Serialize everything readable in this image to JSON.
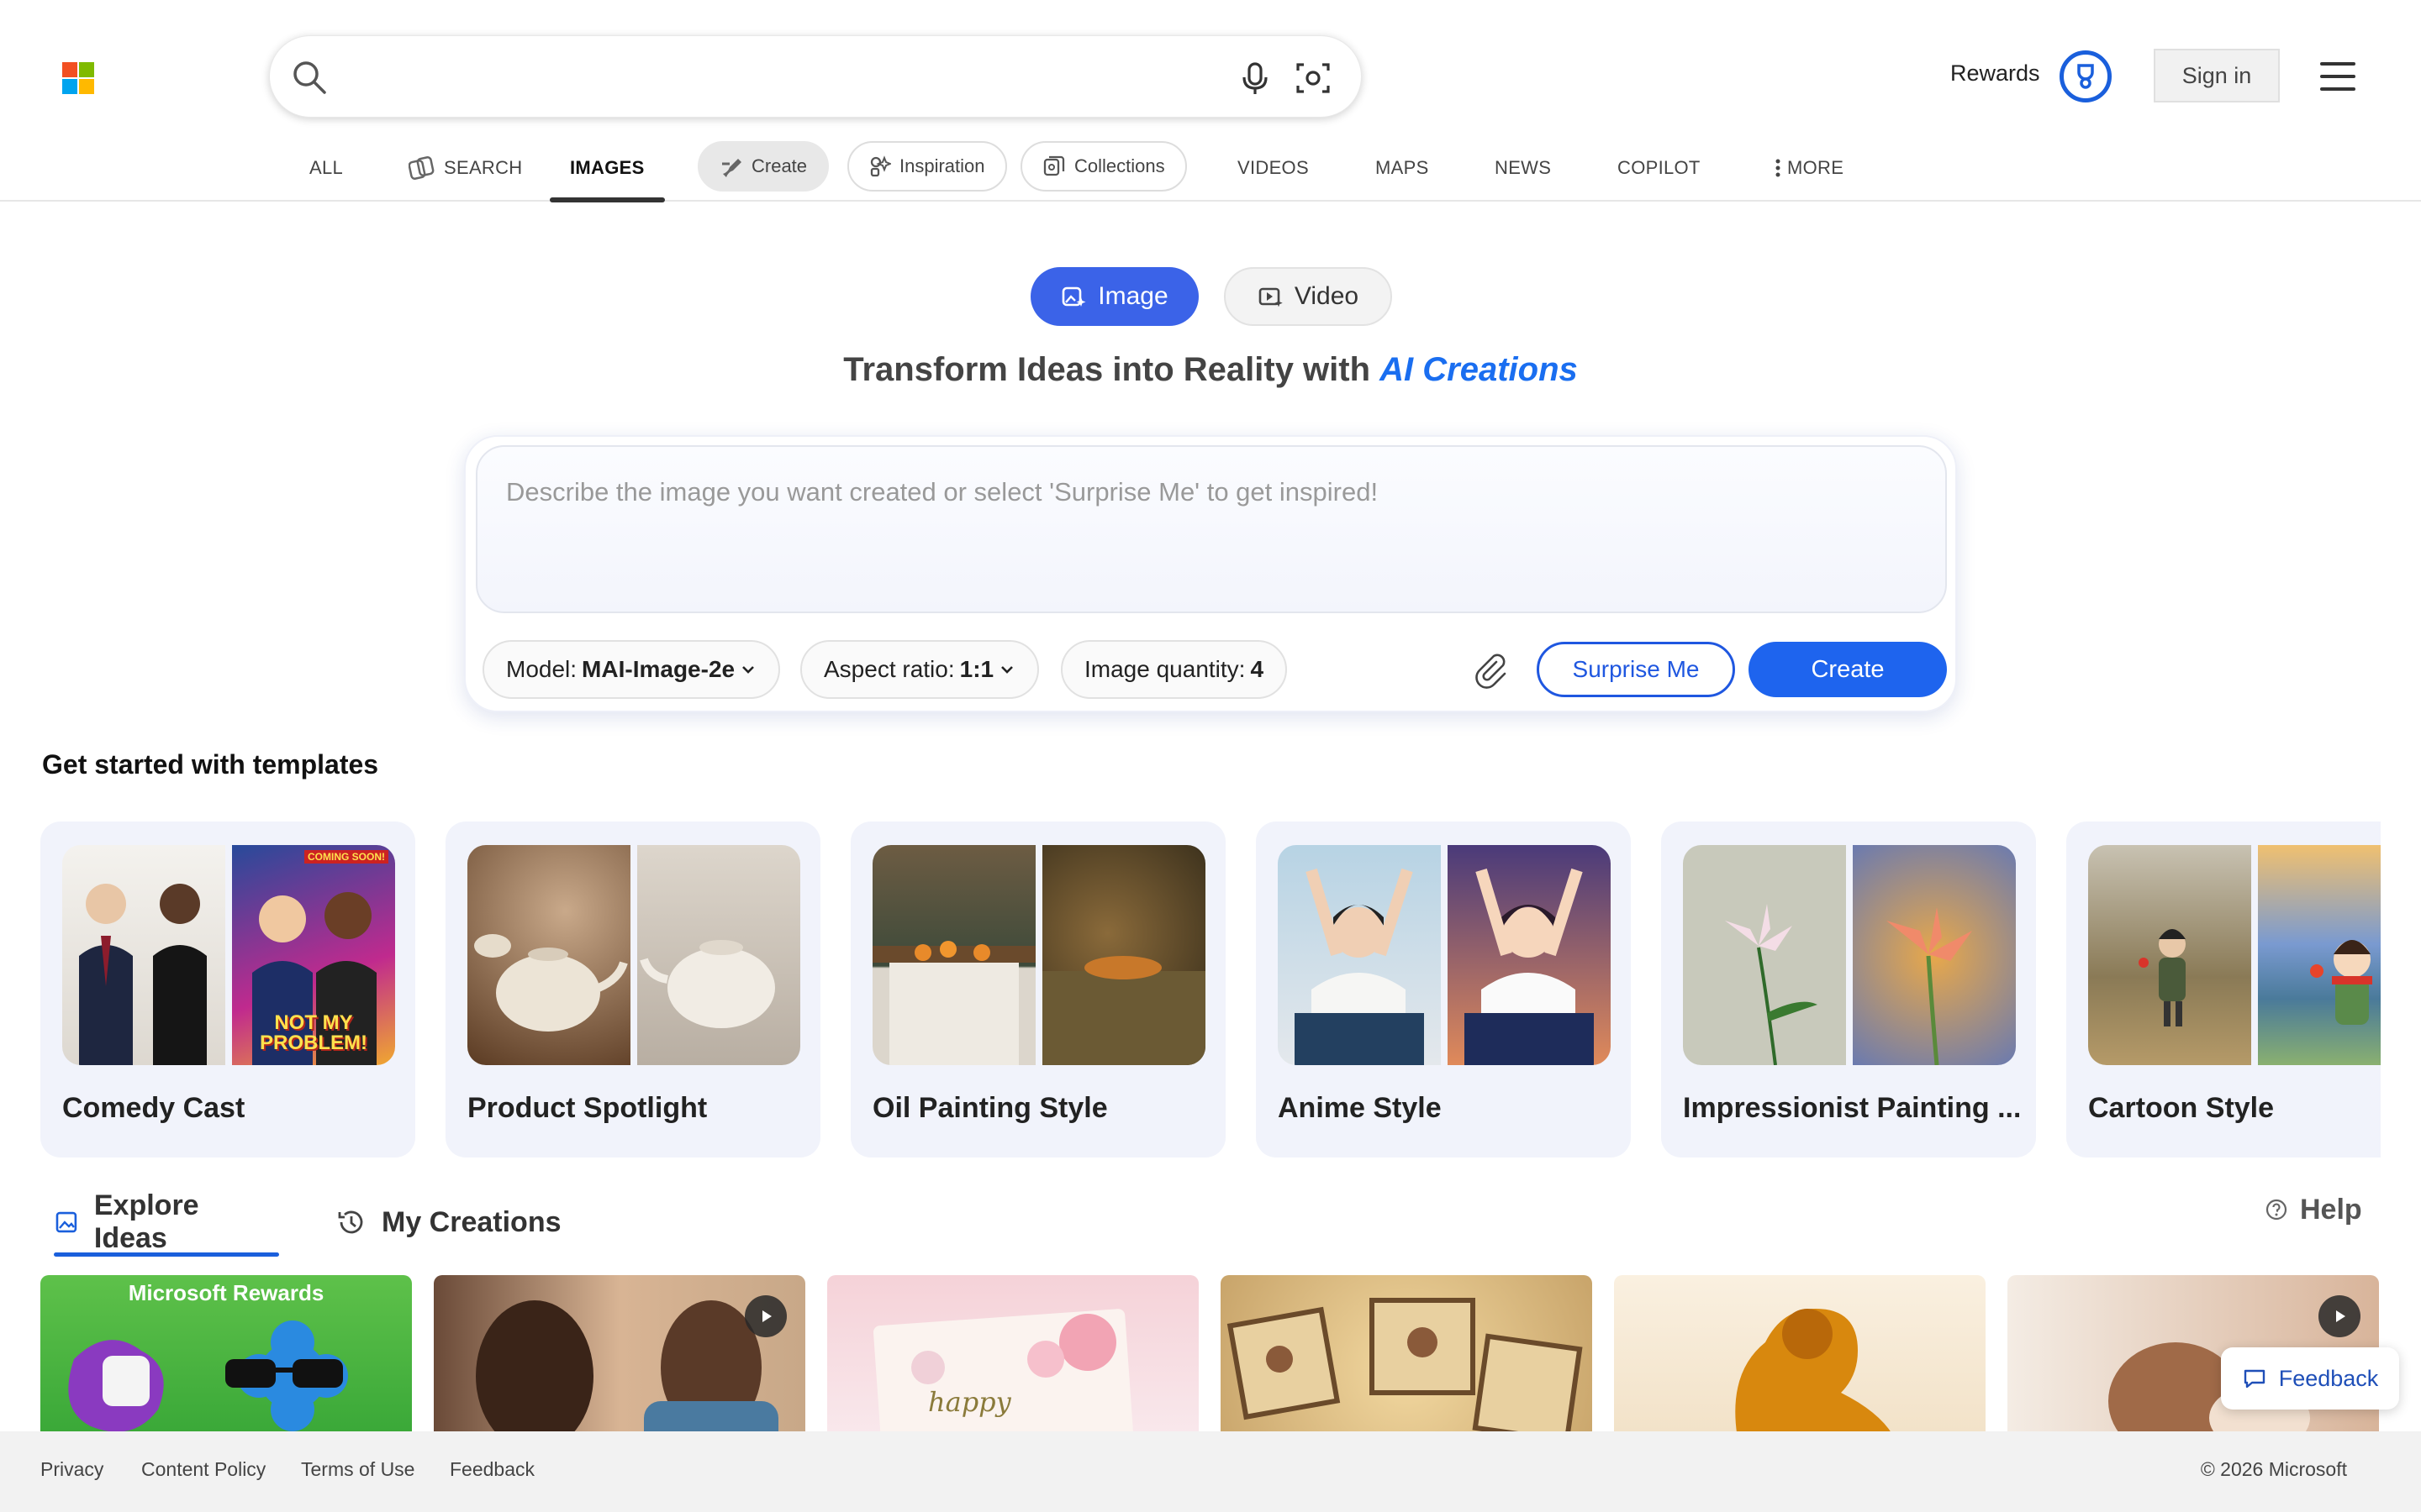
{
  "header": {
    "search": {
      "value": "",
      "placeholder": ""
    },
    "rewards_label": "Rewards",
    "signin_label": "Sign in"
  },
  "nav": {
    "all": "ALL",
    "search": "SEARCH",
    "images": "IMAGES",
    "create": "Create",
    "inspiration": "Inspiration",
    "collections": "Collections",
    "videos": "VIDEOS",
    "maps": "MAPS",
    "news": "NEWS",
    "copilot": "COPILOT",
    "more": "MORE"
  },
  "mode_toggle": {
    "image": "Image",
    "video": "Video",
    "selected": "Image"
  },
  "headline": {
    "prefix": "Transform Ideas into Reality with",
    "highlight": "AI Creations"
  },
  "prompt": {
    "placeholder": "Describe the image you want created or select 'Surprise Me' to get inspired!",
    "value": "",
    "model_label": "Model:",
    "model_value": "MAI-Image-2e",
    "aspect_label": "Aspect ratio:",
    "aspect_value": "1:1",
    "quantity_label": "Image quantity:",
    "quantity_value": "4",
    "surprise_label": "Surprise Me",
    "create_label": "Create"
  },
  "templates": {
    "title": "Get started with templates",
    "items": [
      {
        "label": "Comedy Cast"
      },
      {
        "label": "Product Spotlight"
      },
      {
        "label": "Oil Painting Style"
      },
      {
        "label": "Anime Style"
      },
      {
        "label": "Impressionist Painting ..."
      },
      {
        "label": "Cartoon Style"
      }
    ]
  },
  "poster_text": {
    "coming_soon": "COMING SOON!",
    "not_my_problem": "NOT MY PROBLEM!"
  },
  "tabs": {
    "explore": "Explore Ideas",
    "creations": "My Creations",
    "selected": "Explore Ideas",
    "help": "Help"
  },
  "explore": {
    "card1_banner": "Microsoft Rewards",
    "card3_text": "happy"
  },
  "feedback_label": "Feedback",
  "footer": {
    "privacy": "Privacy",
    "content_policy": "Content Policy",
    "terms": "Terms of Use",
    "feedback": "Feedback",
    "copyright": "© 2026 Microsoft"
  },
  "colors": {
    "accent": "#1e64ee",
    "toggle_active": "#3b63e8",
    "link_italic": "#1a6ef0"
  }
}
